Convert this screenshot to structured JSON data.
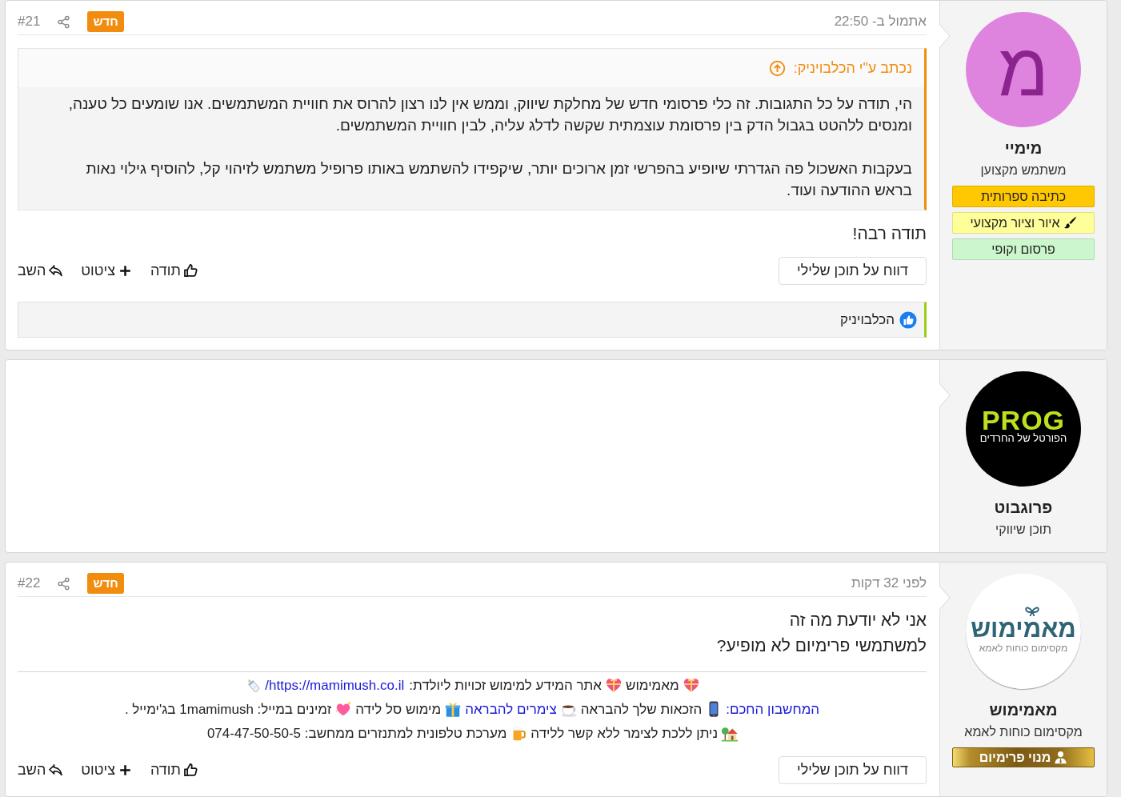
{
  "posts": [
    {
      "kind": "message",
      "date": "אתמול ב- 22:50",
      "new_badge": "חדש",
      "number": "#21",
      "quote": {
        "header": "נכתב ע\"י הכלבויניק:",
        "paragraphs": [
          "הי, תודה על כל התגובות. זה כלי פרסומי חדש של מחלקת שיווק, וממש אין לנו רצון להרוס את חוויית המשתמשים. אנו שומעים כל טענה, ומנסים ללהטט בגבול הדק בין פרסומת עוצמתית שקשה לדלג עליה, לבין חוויית המשתמשים.",
          "בעקבות האשכול פה הגדרתי שיופיע בהפרשי זמן ארוכים יותר, שיקפידו להשתמש באותו פרופיל משתמש לזיהוי קל, להוסיף גילוי נאות בראש ההודעה ועוד."
        ]
      },
      "body": [
        "תודה רבה!"
      ],
      "report": "דווח על תוכן שלילי",
      "actions": [
        {
          "kind": "thanks",
          "label": "תודה"
        },
        {
          "kind": "quote",
          "label": "ציטוט"
        },
        {
          "kind": "reply",
          "label": "השב"
        }
      ],
      "thanked_by": [
        "הכלבויניק"
      ],
      "author": {
        "avatar": {
          "kind": "initial",
          "initial": "מ"
        },
        "name": "מימיי",
        "role": "משתמש מקצוען",
        "badges": [
          {
            "kind": "plain",
            "label": "כתיבה ספרותית",
            "color": "#ffc800"
          },
          {
            "kind": "brush",
            "label": "איור וציור מקצועי",
            "color": "#ffff99"
          },
          {
            "kind": "plain",
            "label": "פרסום וקופי",
            "color": "#ccf7cc"
          }
        ]
      }
    },
    {
      "kind": "blank",
      "author": {
        "avatar": {
          "kind": "dark-logo",
          "wordmark": "PROG",
          "tagline": "הפורטל של החרדים"
        },
        "name": "פרוגבוט",
        "role": "תוכן שיווקי"
      }
    },
    {
      "kind": "message",
      "date": "לפני 32 דקות",
      "new_badge": "חדש",
      "number": "#22",
      "body": [
        "אני לא יודעת מה זה",
        "למשתמשי פרימיום לא מופיע?"
      ],
      "signature": {
        "lines": [
          [
            {
              "kind": "emoji"
            },
            {
              "kind": "text",
              "text": "מאמימוש"
            },
            {
              "kind": "emoji"
            },
            {
              "kind": "text",
              "text": "אתר המידע למימוש זכויות ליולדת:"
            },
            {
              "kind": "link",
              "text": "https://mamimush.co.il/"
            },
            {
              "kind": "emoji"
            }
          ],
          [
            {
              "kind": "link",
              "text": "המחשבון החכם:"
            },
            {
              "kind": "emoji"
            },
            {
              "kind": "text",
              "text": "הזכאות שלך להבראה"
            },
            {
              "kind": "emoji"
            },
            {
              "kind": "link",
              "text": "צימרים להבראה"
            },
            {
              "kind": "emoji"
            },
            {
              "kind": "text",
              "text": "מימוש סל לידה"
            },
            {
              "kind": "emoji"
            },
            {
              "kind": "text",
              "text": "זמינים במייל: 1mamimush בג'ימייל ."
            }
          ],
          [
            {
              "kind": "emoji"
            },
            {
              "kind": "text",
              "text": "ניתן ללכת לצימר ללא קשר ללידה"
            },
            {
              "kind": "emoji"
            },
            {
              "kind": "text",
              "text": "מערכת טלפונית למתנזרים ממחשב: 074-47-50-50-5"
            }
          ]
        ]
      },
      "report": "דווח על תוכן שלילי",
      "actions": [
        {
          "kind": "thanks",
          "label": "תודה"
        },
        {
          "kind": "quote",
          "label": "ציטוט"
        },
        {
          "kind": "reply",
          "label": "השב"
        }
      ],
      "author": {
        "avatar": {
          "kind": "light-logo",
          "wordmark": "מאמימוש",
          "tagline": "מקסימום כוחות לאמא"
        },
        "name": "מאמימוש",
        "role": "מקסימום כוחות לאמא",
        "badges": [
          {
            "kind": "premium",
            "label": "מנוי פרימיום"
          }
        ]
      }
    }
  ]
}
